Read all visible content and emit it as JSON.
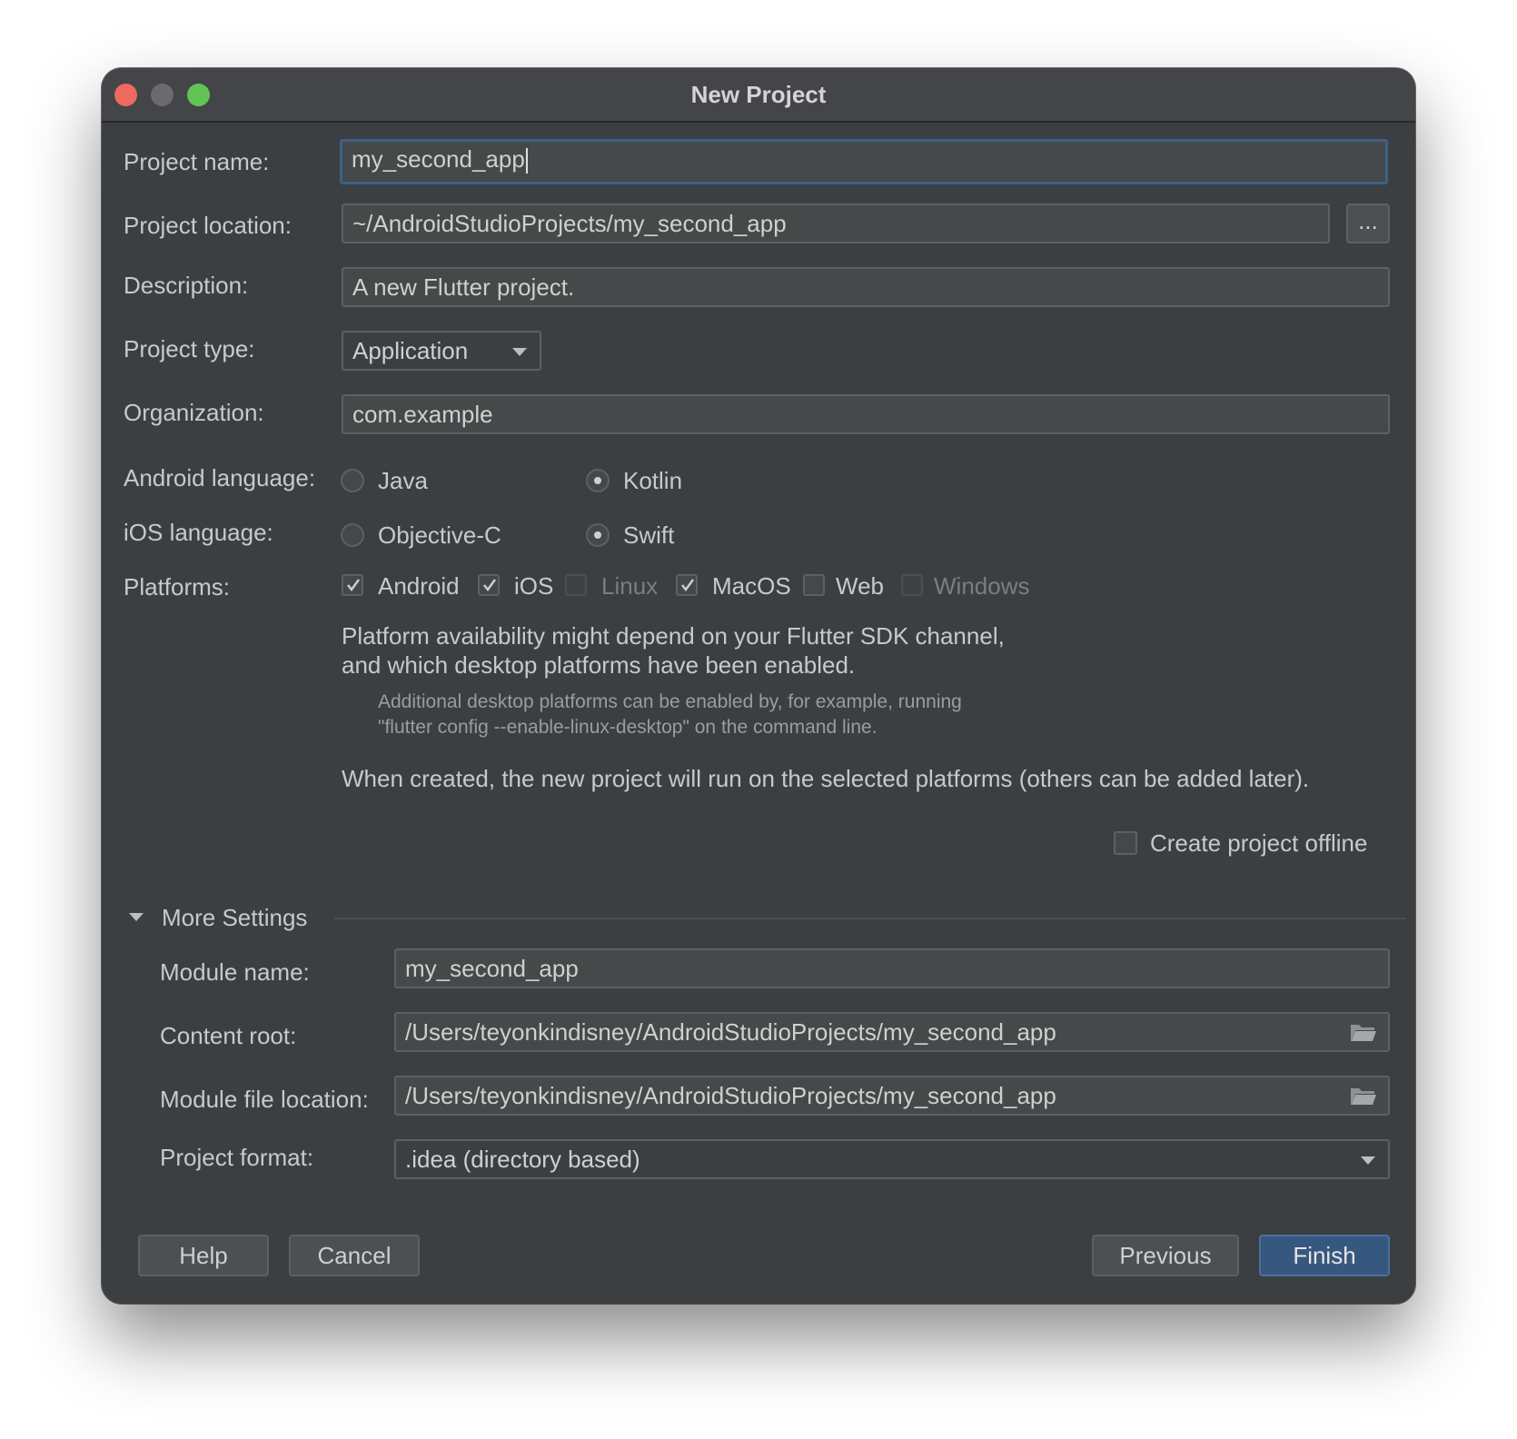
{
  "window": {
    "title": "New Project"
  },
  "form": {
    "project_name": {
      "label": "Project name:",
      "value": "my_second_app"
    },
    "project_location": {
      "label": "Project location:",
      "value": "~/AndroidStudioProjects/my_second_app",
      "browse_label": "..."
    },
    "description": {
      "label": "Description:",
      "value": "A new Flutter project."
    },
    "project_type": {
      "label": "Project type:",
      "value": "Application"
    },
    "organization": {
      "label": "Organization:",
      "value": "com.example"
    },
    "android_language": {
      "label": "Android language:",
      "options": [
        "Java",
        "Kotlin"
      ],
      "selected": "Kotlin"
    },
    "ios_language": {
      "label": "iOS language:",
      "options": [
        "Objective-C",
        "Swift"
      ],
      "selected": "Swift"
    },
    "platforms": {
      "label": "Platforms:",
      "items": [
        {
          "label": "Android",
          "checked": true,
          "enabled": true
        },
        {
          "label": "iOS",
          "checked": true,
          "enabled": true
        },
        {
          "label": "Linux",
          "checked": false,
          "enabled": false
        },
        {
          "label": "MacOS",
          "checked": true,
          "enabled": true
        },
        {
          "label": "Web",
          "checked": false,
          "enabled": true
        },
        {
          "label": "Windows",
          "checked": false,
          "enabled": false
        }
      ]
    },
    "platform_note_1": "Platform availability might depend on your Flutter SDK channel,",
    "platform_note_2": "and which desktop platforms have been enabled.",
    "platform_hint_1": "Additional desktop platforms can be enabled by, for example, running",
    "platform_hint_2": "\"flutter config --enable-linux-desktop\" on the command line.",
    "platform_note_3": "When created, the new project will run on the selected platforms (others can be added later).",
    "offline": {
      "label": "Create project offline",
      "checked": false
    }
  },
  "more_settings": {
    "title": "More Settings",
    "module_name": {
      "label": "Module name:",
      "value": "my_second_app"
    },
    "content_root": {
      "label": "Content root:",
      "value": "/Users/teyonkindisney/AndroidStudioProjects/my_second_app"
    },
    "module_file_location": {
      "label": "Module file location:",
      "value": "/Users/teyonkindisney/AndroidStudioProjects/my_second_app"
    },
    "project_format": {
      "label": "Project format:",
      "value": ".idea (directory based)"
    }
  },
  "buttons": {
    "help": "Help",
    "cancel": "Cancel",
    "previous": "Previous",
    "finish": "Finish"
  },
  "colors": {
    "background": "#3c3f41",
    "field": "#45494a",
    "focus": "#3d6185",
    "primary_button": "#365880"
  }
}
